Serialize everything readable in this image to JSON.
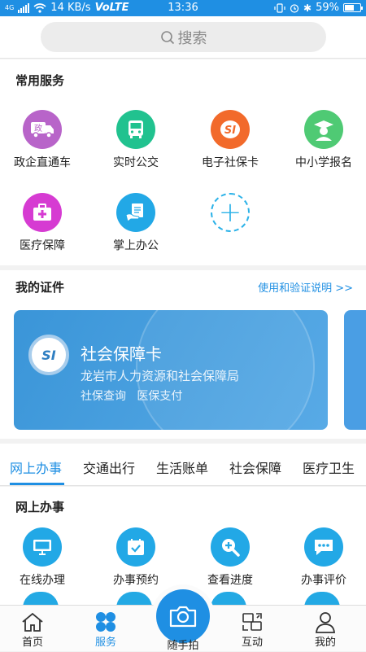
{
  "status": {
    "network": "4G",
    "speed": "14 KB/s",
    "volte": "VoLTE",
    "time": "13:36",
    "battery": "59%"
  },
  "search": {
    "placeholder": "搜索"
  },
  "common_services": {
    "title": "常用服务",
    "items": [
      {
        "label": "政企直通车",
        "icon": "truck-icon",
        "color": "#b864c9"
      },
      {
        "label": "实时公交",
        "icon": "bus-icon",
        "color": "#21c28f"
      },
      {
        "label": "电子社保卡",
        "icon": "social-security-icon",
        "color": "#f26a2b"
      },
      {
        "label": "中小学报名",
        "icon": "student-icon",
        "color": "#4fca74"
      },
      {
        "label": "医疗保障",
        "icon": "medical-kit-icon",
        "color": "#d63bd2"
      },
      {
        "label": "掌上办公",
        "icon": "hand-document-icon",
        "color": "#22a8e6"
      }
    ],
    "add_icon": "plus-icon"
  },
  "certificates": {
    "title": "我的证件",
    "link": "使用和验证说明 >>",
    "card": {
      "logo": "SI",
      "title": "社会保障卡",
      "issuer": "龙岩市人力资源和社会保障局",
      "actions": "社保查询   医保支付"
    }
  },
  "tabs": [
    "网上办事",
    "交通出行",
    "生活账单",
    "社会保障",
    "医疗卫生"
  ],
  "online": {
    "title": "网上办事",
    "items": [
      {
        "label": "在线办理",
        "icon": "monitor-icon",
        "color": "#22a8e6"
      },
      {
        "label": "办事预约",
        "icon": "calendar-check-icon",
        "color": "#22a8e6"
      },
      {
        "label": "查看进度",
        "icon": "magnifier-plus-icon",
        "color": "#22a8e6"
      },
      {
        "label": "办事评价",
        "icon": "chat-bubble-icon",
        "color": "#22a8e6"
      }
    ]
  },
  "nav": {
    "home": "首页",
    "service": "服务",
    "camera": "随手拍",
    "interact": "互动",
    "mine": "我的"
  }
}
